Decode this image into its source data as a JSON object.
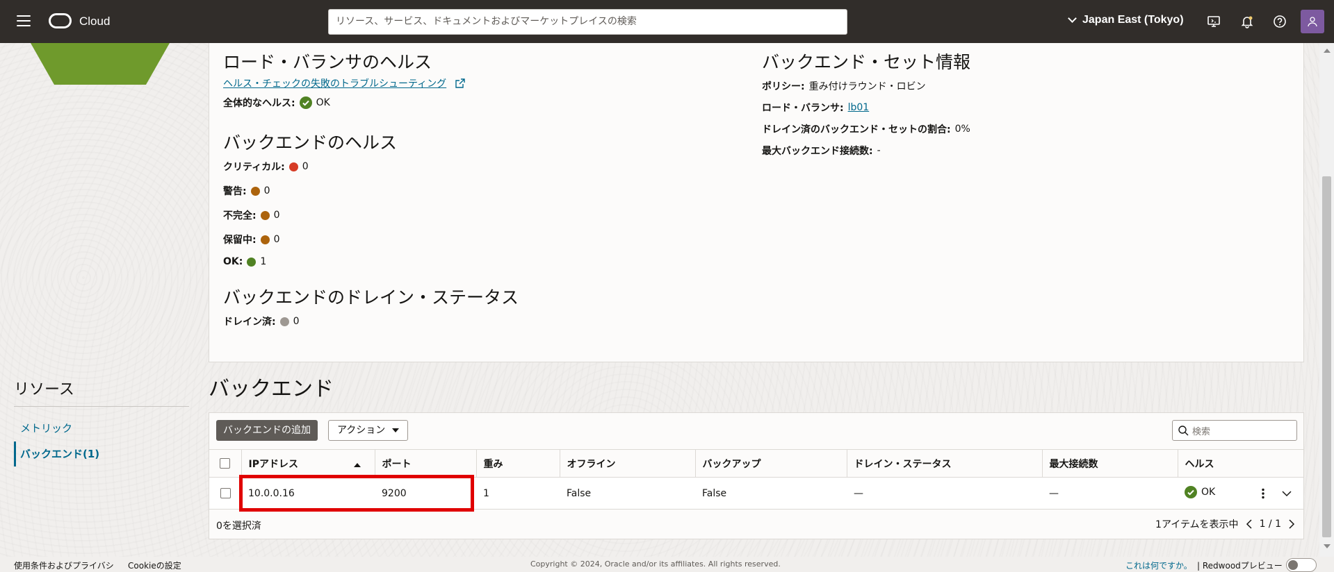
{
  "header": {
    "brand": "Cloud",
    "search_placeholder": "リソース、サービス、ドキュメントおよびマーケットプレイスの検索",
    "region": "Japan East (Tokyo)"
  },
  "lb_health": {
    "title": "ロード・バランサのヘルス",
    "troubleshoot_link": "ヘルス・チェックの失敗のトラブルシューティング",
    "overall_label": "全体的なヘルス:",
    "overall_value": "OK"
  },
  "backend_health": {
    "title": "バックエンドのヘルス",
    "items": [
      {
        "label": "クリティカル:",
        "value": "0",
        "color": "#d63b25"
      },
      {
        "label": "警告:",
        "value": "0",
        "color": "#ac630c"
      },
      {
        "label": "不完全:",
        "value": "0",
        "color": "#ac630c"
      },
      {
        "label": "保留中:",
        "value": "0",
        "color": "#ac630c"
      },
      {
        "label": "OK:",
        "value": "1",
        "color": "#508223"
      }
    ]
  },
  "drain_status": {
    "title": "バックエンドのドレイン・ステータス",
    "label": "ドレイン済:",
    "value": "0",
    "color": "#9e9892"
  },
  "backend_set_info": {
    "title": "バックエンド・セット情報",
    "policy_label": "ポリシー:",
    "policy_value": "重み付けラウンド・ロビン",
    "lb_label": "ロード・バランサ:",
    "lb_value": "lb01",
    "drained_ratio_label": "ドレイン済のバックエンド・セットの割合:",
    "drained_ratio_value": "0%",
    "max_conn_label": "最大バックエンド接続数:",
    "max_conn_value": "-"
  },
  "resources": {
    "title": "リソース",
    "items": [
      "メトリック",
      "バックエンド(1)"
    ]
  },
  "backends": {
    "title": "バックエンド",
    "add_button": "バックエンドの追加",
    "actions_button": "アクション",
    "search_placeholder": "検索",
    "columns": [
      "IPアドレス",
      "ポート",
      "重み",
      "オフライン",
      "バックアップ",
      "ドレイン・ステータス",
      "最大接続数",
      "ヘルス"
    ],
    "rows": [
      {
        "ip": "10.0.0.16",
        "port": "9200",
        "weight": "1",
        "offline": "False",
        "backup": "False",
        "drain": "—",
        "max_conn": "—",
        "health": "OK"
      }
    ],
    "selected": "0を選択済",
    "items_shown": "1アイテムを表示中",
    "page": "1 / 1"
  },
  "footer": {
    "terms": "使用条件およびプライバシ",
    "cookie": "Cookieの設定",
    "copyright": "Copyright © 2024, Oracle and/or its affiliates. All rights reserved.",
    "what_is": "これは何ですか。",
    "redwood": "| Redwoodプレビュー"
  },
  "colors": {
    "header_bg": "#312d2a",
    "ok_green": "#508223",
    "link": "#00688c",
    "highlight_red": "#e00000"
  }
}
